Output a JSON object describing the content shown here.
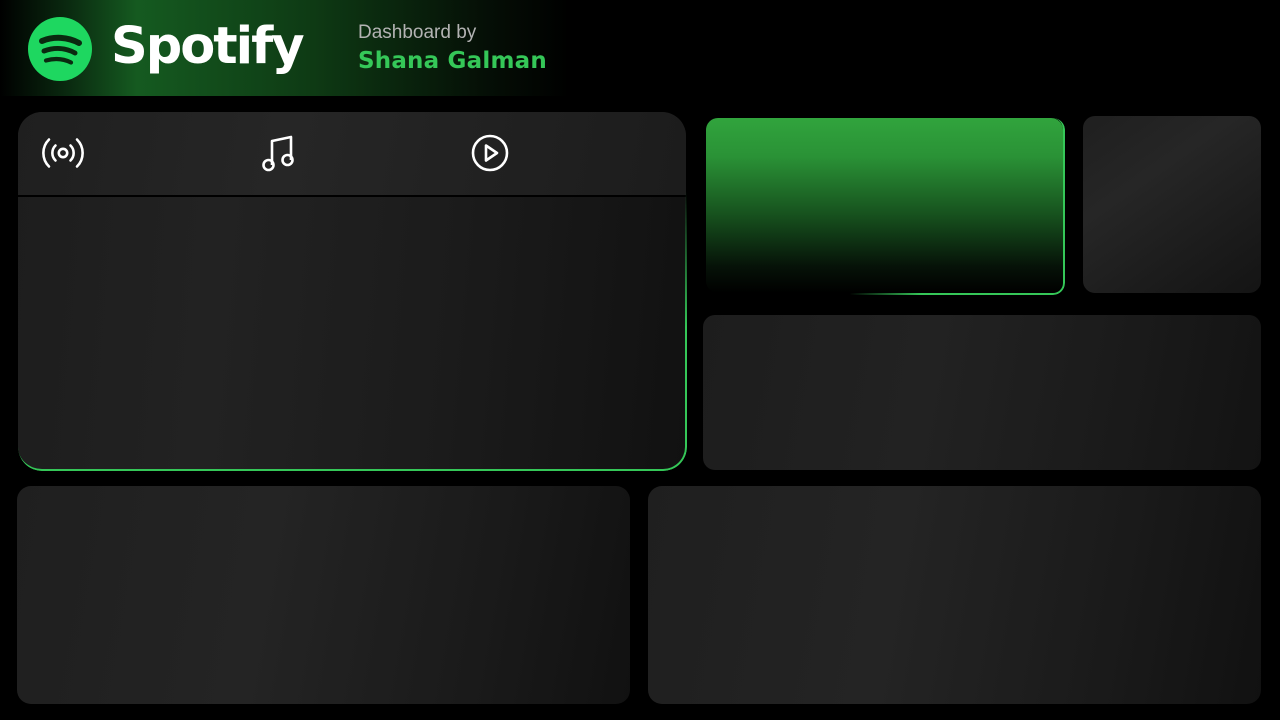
{
  "header": {
    "brand": "Spotify",
    "byline": "Dashboard by",
    "author": "Shana Galman"
  },
  "main_panel": {
    "tabs": [
      {
        "icon": "podcast-broadcast-icon"
      },
      {
        "icon": "music-note-icon"
      },
      {
        "icon": "play-circle-icon"
      }
    ]
  },
  "theme": {
    "accent": "#35c758",
    "background": "#000000",
    "panel": "#222222",
    "byline_color": "#b3b3b3"
  }
}
